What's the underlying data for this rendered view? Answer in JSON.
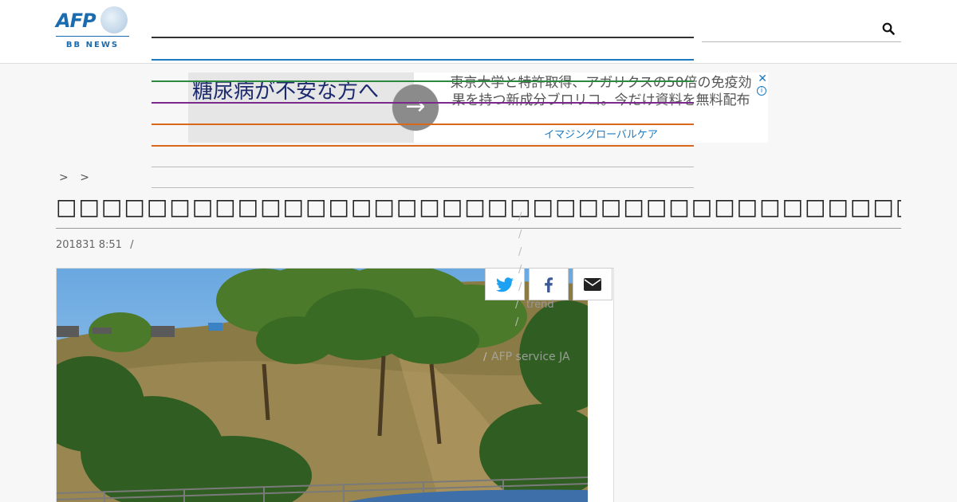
{
  "header": {
    "logo": {
      "brand": "AFP",
      "sub": "BB NEWS"
    },
    "search": {
      "placeholder": ""
    }
  },
  "ad": {
    "headline": "糖尿病が不安な方へ",
    "copy": "東京大学と特許取得、アガリクスの50倍の免疫効果を持つ新成分ブロリコ。今だけ資料を無料配布",
    "advertiser": "イマジングローバルケア",
    "close_glyph": "✕",
    "info_glyph": "i",
    "arrow_glyph": "→"
  },
  "breadcrumb": {
    "sep1": ">",
    "sep2": ">"
  },
  "article": {
    "title": "□□□□□□□□□□□□□□□□□□□□□□□□□□□□□□□□□□□□□□",
    "date": "201831 8:51",
    "date_sep": "/",
    "photo_credit": "AFP service JA",
    "trend_label": "trend"
  },
  "share": {
    "twitter_icon": "twitter-icon",
    "facebook_icon": "facebook-icon",
    "mail_icon": "mail-icon"
  },
  "ghost_slashes": [
    "/",
    "/",
    "/",
    "/",
    "/",
    "/",
    "/",
    "/"
  ],
  "colors": {
    "brand_blue": "#1a6bb0",
    "nav_dark": "#333333",
    "nav_blue": "#1b7ac0",
    "nav_green": "#2c8a3e",
    "nav_purple": "#7a2a8a",
    "nav_orange": "#d9681b",
    "background": "#f7f7f7"
  }
}
